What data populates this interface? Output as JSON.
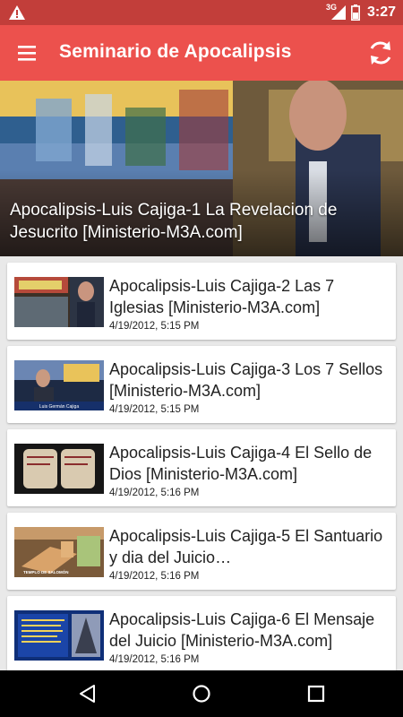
{
  "status_bar": {
    "network": "3G",
    "time": "3:27",
    "icons": [
      "warning-icon",
      "signal-icon",
      "battery-icon"
    ]
  },
  "app_bar": {
    "title": "Seminario de Apocalipsis",
    "icons": [
      "menu-icon",
      "refresh-icon"
    ]
  },
  "featured": {
    "title": "Apocalipsis-Luis Cajiga-1 La Revelacion de Jesucrito [Ministerio-M3A.com]"
  },
  "videos": [
    {
      "title": "Apocalipsis-Luis Cajiga-2 Las 7 Iglesias  [Ministerio-M3A.com]",
      "date": "4/19/2012, 5:15 PM"
    },
    {
      "title": "Apocalipsis-Luis Cajiga-3 Los 7 Sellos [Ministerio-M3A.com]",
      "date": "4/19/2012, 5:15 PM"
    },
    {
      "title": "Apocalipsis-Luis Cajiga-4 El Sello de Dios [Ministerio-M3A.com]",
      "date": "4/19/2012, 5:16 PM"
    },
    {
      "title": "Apocalipsis-Luis Cajiga-5 El Santuario y dia del Juicio…",
      "date": "4/19/2012, 5:16 PM"
    },
    {
      "title": "Apocalipsis-Luis Cajiga-6 El Mensaje del Juicio [Ministerio-M3A.com]",
      "date": "4/19/2012, 5:16 PM"
    }
  ],
  "thumbnails": {
    "card_2": "Luis Germán Cajiga",
    "card_5": "TEMPLO DE SALOMÓN"
  },
  "nav_bar": {
    "icons": [
      "back-icon",
      "home-icon",
      "recents-icon"
    ]
  },
  "colors": {
    "status_bar": "#c23e3a",
    "app_bar": "#ec514d",
    "list_background": "#e9e9e9",
    "card": "#ffffff"
  }
}
